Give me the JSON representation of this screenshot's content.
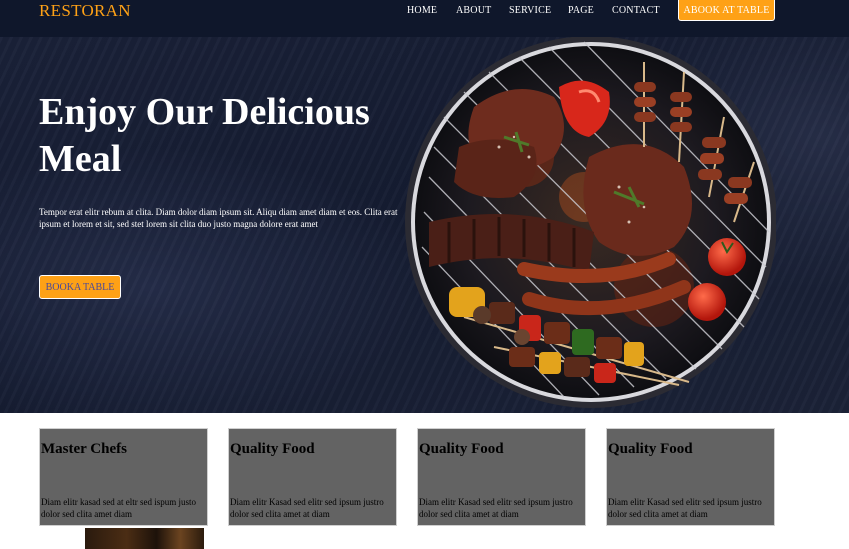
{
  "navbar": {
    "brand": "RESTORAN",
    "links": [
      {
        "label": "HOME"
      },
      {
        "label": "ABOUT"
      },
      {
        "label": "SERVICE"
      },
      {
        "label": "PAGE"
      },
      {
        "label": "CONTACT"
      }
    ],
    "book_button": "ABOOK AT TABLE"
  },
  "hero": {
    "title": "Enjoy Our Delicious Meal",
    "text": "Tempor erat elitr rebum at clita. Diam dolor diam ipsum sit. Aliqu diam amet diam et eos. Clita erat ipsum et lorem et sit, sed stet lorem sit clita duo justo magna dolore erat amet",
    "button": "BOOKA TABLE"
  },
  "services": [
    {
      "title": "Master Chefs",
      "text": "Diam elitr kasad sed at eltr sed ispum justo dolor sed clita amet diam"
    },
    {
      "title": "Quality Food",
      "text": "Diam elitr Kasad sed elitr sed ipsum justro dolor sed clita amet at diam"
    },
    {
      "title": "Quality Food",
      "text": "Diam elitr Kasad sed elitr sed ipsum justro dolor sed clita amet at diam"
    },
    {
      "title": "Quality Food",
      "text": "Diam elitr Kasad sed elitr sed ipsum justro dolor sed clita amet at diam"
    }
  ],
  "colors": {
    "primary": "#fea116",
    "dark": "#0f172b",
    "card_bg": "#636363"
  },
  "icons": {
    "hero_image": "grilled-food-image"
  }
}
